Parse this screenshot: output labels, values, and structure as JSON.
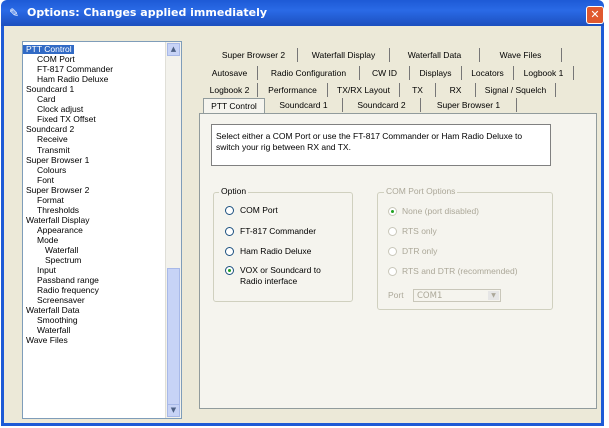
{
  "window": {
    "title": "Options: Changes applied immediately",
    "close_label": "✕",
    "app_icon": "options-app-icon"
  },
  "tree": {
    "items": [
      {
        "label": "PTT Control",
        "level": 0,
        "selected": true
      },
      {
        "label": "COM Port",
        "level": 1
      },
      {
        "label": "FT-817 Commander",
        "level": 1
      },
      {
        "label": "Ham Radio Deluxe",
        "level": 1
      },
      {
        "label": "Soundcard 1",
        "level": 0
      },
      {
        "label": "Card",
        "level": 1
      },
      {
        "label": "Clock adjust",
        "level": 1
      },
      {
        "label": "Fixed TX Offset",
        "level": 1
      },
      {
        "label": "Soundcard 2",
        "level": 0
      },
      {
        "label": "Receive",
        "level": 1
      },
      {
        "label": "Transmit",
        "level": 1
      },
      {
        "label": "Super Browser 1",
        "level": 0
      },
      {
        "label": "Colours",
        "level": 1
      },
      {
        "label": "Font",
        "level": 1
      },
      {
        "label": "Super Browser 2",
        "level": 0
      },
      {
        "label": "Format",
        "level": 1
      },
      {
        "label": "Thresholds",
        "level": 1
      },
      {
        "label": "Waterfall Display",
        "level": 0
      },
      {
        "label": "Appearance",
        "level": 1
      },
      {
        "label": "Mode",
        "level": 1
      },
      {
        "label": "Waterfall",
        "level": 2
      },
      {
        "label": "Spectrum",
        "level": 2
      },
      {
        "label": "Input",
        "level": 1
      },
      {
        "label": "Passband range",
        "level": 1
      },
      {
        "label": "Radio frequency",
        "level": 1
      },
      {
        "label": "Screensaver",
        "level": 1
      },
      {
        "label": "Waterfall Data",
        "level": 0
      },
      {
        "label": "Smoothing",
        "level": 1
      },
      {
        "label": "Waterfall",
        "level": 1
      },
      {
        "label": "Wave Files",
        "level": 0
      }
    ]
  },
  "tabs": {
    "row1": [
      "Super Browser 2",
      "Waterfall Display",
      "Waterfall Data",
      "Wave Files"
    ],
    "row2": [
      "Autosave",
      "Radio Configuration",
      "CW ID",
      "Displays",
      "Locators",
      "Logbook 1"
    ],
    "row3": [
      "Logbook 2",
      "Performance",
      "TX/RX Layout",
      "TX",
      "RX",
      "Signal / Squelch"
    ],
    "row4": [
      "PTT Control",
      "Soundcard 1",
      "Soundcard 2",
      "Super Browser 1"
    ],
    "active": "PTT Control"
  },
  "info_text": "Select either a COM Port or use the FT-817 Commander or Ham Radio Deluxe to switch your rig between RX and TX.",
  "option_group": {
    "label": "Option",
    "options": [
      {
        "label": "COM Port",
        "checked": false
      },
      {
        "label": "FT-817 Commander",
        "checked": false
      },
      {
        "label": "Ham Radio Deluxe",
        "checked": false
      },
      {
        "label": "VOX or Soundcard to Radio interface",
        "checked": true
      }
    ]
  },
  "com_group": {
    "label": "COM Port Options",
    "options": [
      {
        "label": "None (port disabled)",
        "checked": true
      },
      {
        "label": "RTS only",
        "checked": false
      },
      {
        "label": "DTR only",
        "checked": false
      },
      {
        "label": "RTS and DTR (recommended)",
        "checked": false
      }
    ],
    "port_label": "Port",
    "port_value": "COM1"
  }
}
